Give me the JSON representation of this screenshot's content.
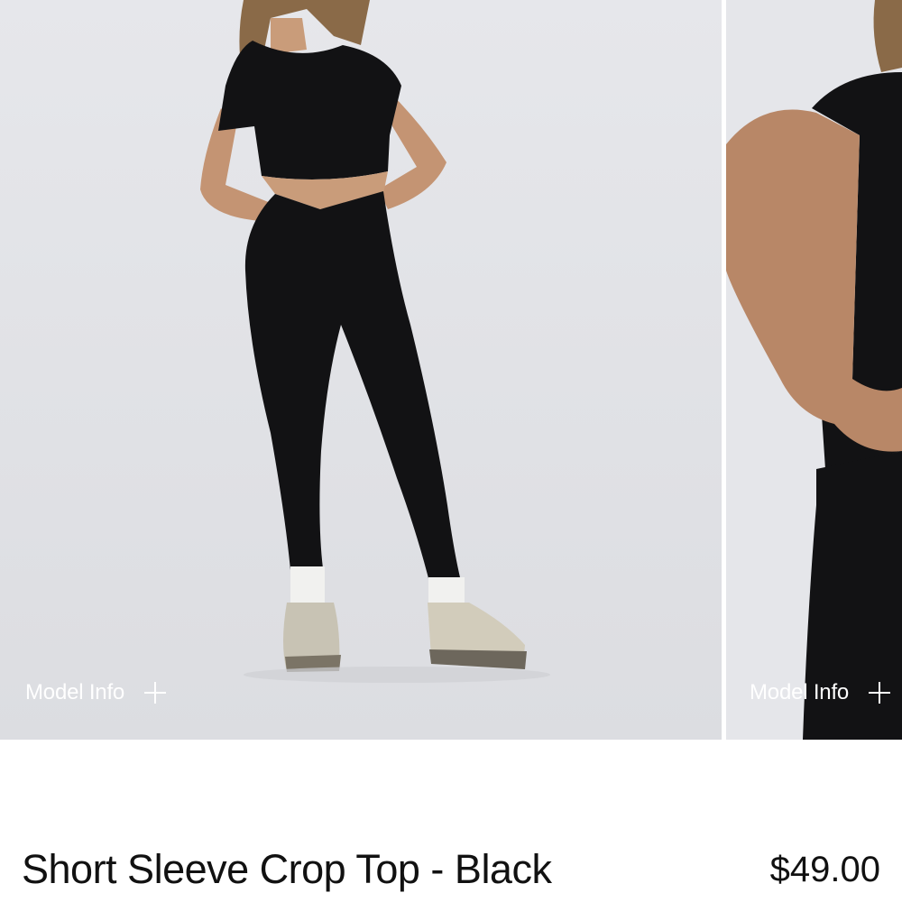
{
  "gallery": {
    "slides": [
      {
        "model_info_label": "Model Info"
      },
      {
        "model_info_label": "Model Info"
      }
    ]
  },
  "product": {
    "title": "Short Sleeve Crop Top - Black",
    "price": "$49.00"
  },
  "colors": {
    "background": "#ffffff",
    "photo_background": "#e4e5e9",
    "garment": "#121214",
    "text": "#111111"
  }
}
